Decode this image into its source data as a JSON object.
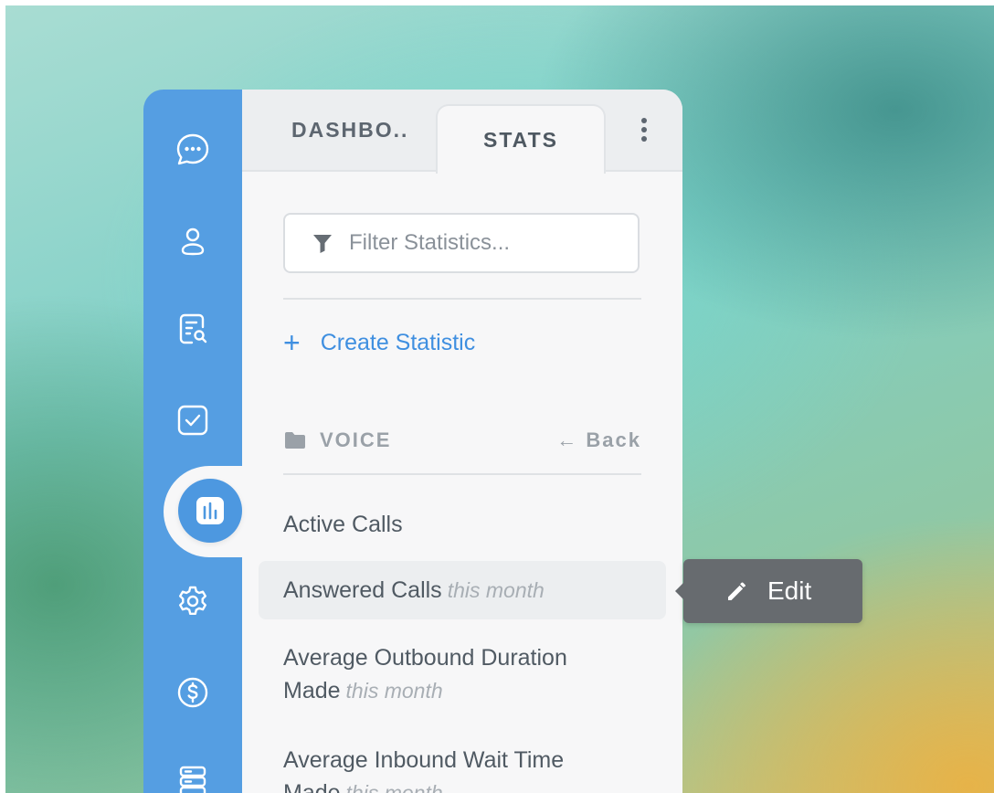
{
  "tabs": {
    "dashboard_label": "DASHBO..",
    "stats_label": "STATS"
  },
  "filter": {
    "placeholder": "Filter Statistics..."
  },
  "create": {
    "label": "Create Statistic"
  },
  "folder": {
    "name": "VOICE",
    "back_label": "← Back"
  },
  "statistics": [
    {
      "name": "Active Calls",
      "period": ""
    },
    {
      "name": "Answered Calls",
      "period": "this month"
    },
    {
      "name": "Average Outbound Duration Made",
      "period": "this month"
    },
    {
      "name": "Average Inbound Wait Time Made",
      "period": "this month"
    }
  ],
  "tooltip": {
    "label": "Edit"
  },
  "sidebar": {
    "icons": [
      "chat-icon",
      "user-icon",
      "report-search-icon",
      "checkbox-icon",
      "stats-icon",
      "gear-icon",
      "dollar-icon",
      "server-icon"
    ],
    "active": "stats-icon"
  },
  "colors": {
    "sidebar": "#559ee2",
    "accent": "#3f8fe0",
    "tooltip": "#676b6f"
  }
}
